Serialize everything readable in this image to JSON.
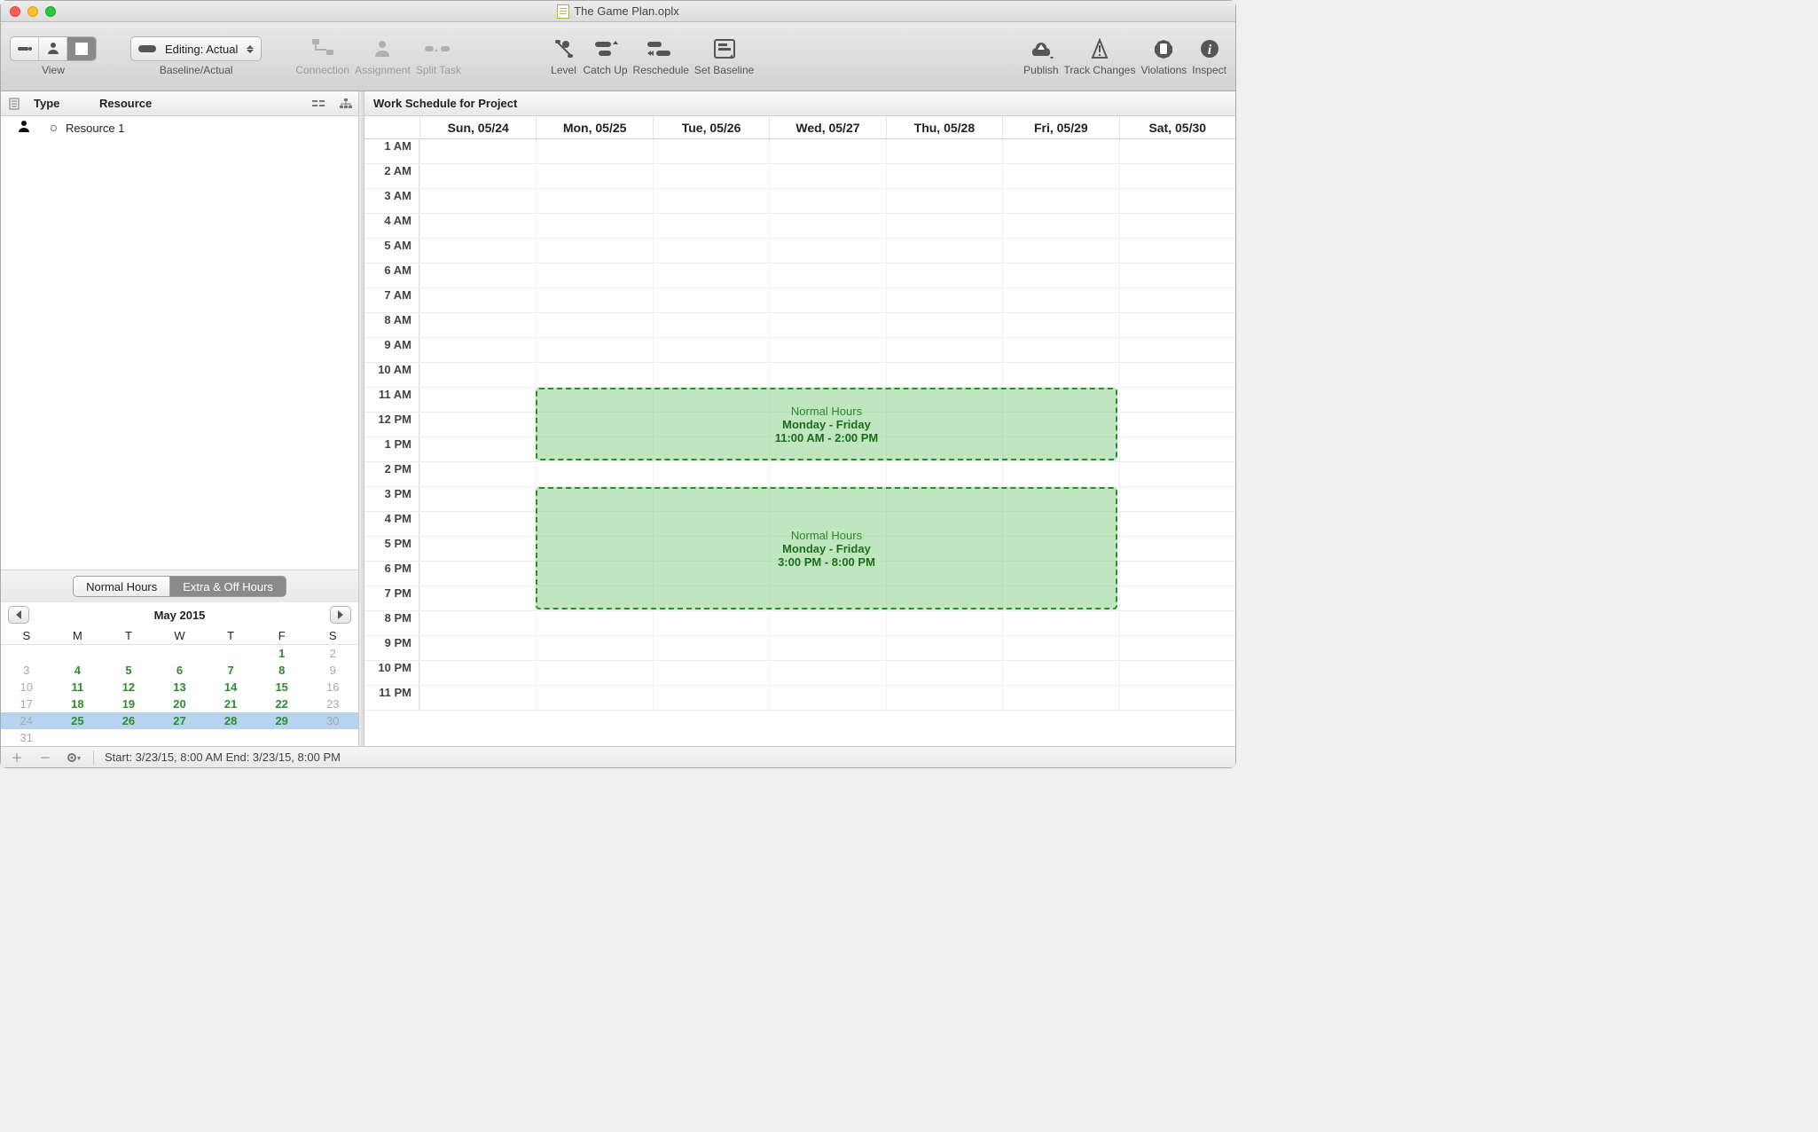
{
  "window": {
    "title": "The Game Plan.oplx"
  },
  "toolbar": {
    "view_label": "View",
    "baseline_actual_label": "Baseline/Actual",
    "editing_label": "Editing: Actual",
    "connection": "Connection",
    "assignment": "Assignment",
    "split_task": "Split Task",
    "level": "Level",
    "catch_up": "Catch Up",
    "reschedule": "Reschedule",
    "set_baseline": "Set Baseline",
    "publish": "Publish",
    "track_changes": "Track Changes",
    "violations": "Violations",
    "inspect": "Inspect"
  },
  "outline": {
    "type_header": "Type",
    "resource_header": "Resource",
    "rows": [
      {
        "name": "Resource 1"
      }
    ]
  },
  "hours_tabs": {
    "normal": "Normal Hours",
    "extra": "Extra & Off Hours"
  },
  "calendar": {
    "month_label": "May 2015",
    "dow": [
      "S",
      "M",
      "T",
      "W",
      "T",
      "F",
      "S"
    ],
    "weeks": [
      [
        {
          "d": "",
          "c": "gray"
        },
        {
          "d": "",
          "c": "gray"
        },
        {
          "d": "",
          "c": "gray"
        },
        {
          "d": "",
          "c": "gray"
        },
        {
          "d": "",
          "c": "gray"
        },
        {
          "d": "1",
          "c": "green"
        },
        {
          "d": "2",
          "c": "gray"
        }
      ],
      [
        {
          "d": "3",
          "c": "gray"
        },
        {
          "d": "4",
          "c": "green"
        },
        {
          "d": "5",
          "c": "green"
        },
        {
          "d": "6",
          "c": "green"
        },
        {
          "d": "7",
          "c": "green"
        },
        {
          "d": "8",
          "c": "green"
        },
        {
          "d": "9",
          "c": "gray"
        }
      ],
      [
        {
          "d": "10",
          "c": "gray"
        },
        {
          "d": "11",
          "c": "green"
        },
        {
          "d": "12",
          "c": "green"
        },
        {
          "d": "13",
          "c": "green"
        },
        {
          "d": "14",
          "c": "green"
        },
        {
          "d": "15",
          "c": "green"
        },
        {
          "d": "16",
          "c": "gray"
        }
      ],
      [
        {
          "d": "17",
          "c": "gray"
        },
        {
          "d": "18",
          "c": "green"
        },
        {
          "d": "19",
          "c": "green"
        },
        {
          "d": "20",
          "c": "green"
        },
        {
          "d": "21",
          "c": "green"
        },
        {
          "d": "22",
          "c": "green"
        },
        {
          "d": "23",
          "c": "gray"
        }
      ],
      [
        {
          "d": "24",
          "c": "gray"
        },
        {
          "d": "25",
          "c": "green"
        },
        {
          "d": "26",
          "c": "green"
        },
        {
          "d": "27",
          "c": "green"
        },
        {
          "d": "28",
          "c": "green"
        },
        {
          "d": "29",
          "c": "green"
        },
        {
          "d": "30",
          "c": "gray"
        }
      ],
      [
        {
          "d": "31",
          "c": "gray"
        },
        {
          "d": "",
          "c": "gray"
        },
        {
          "d": "",
          "c": "gray"
        },
        {
          "d": "",
          "c": "gray"
        },
        {
          "d": "",
          "c": "gray"
        },
        {
          "d": "",
          "c": "gray"
        },
        {
          "d": "",
          "c": "gray"
        }
      ]
    ],
    "selected_week_index": 4
  },
  "schedule": {
    "title": "Work Schedule for Project",
    "days": [
      "Sun, 05/24",
      "Mon, 05/25",
      "Tue, 05/26",
      "Wed, 05/27",
      "Thu, 05/28",
      "Fri, 05/29",
      "Sat, 05/30"
    ],
    "hours": [
      "1 AM",
      "2 AM",
      "3 AM",
      "4 AM",
      "5 AM",
      "6 AM",
      "7 AM",
      "8 AM",
      "9 AM",
      "10 AM",
      "11 AM",
      "12 PM",
      "1 PM",
      "2 PM",
      "3 PM",
      "4 PM",
      "5 PM",
      "6 PM",
      "7 PM",
      "8 PM",
      "9 PM",
      "10 PM",
      "11 PM"
    ],
    "blocks": [
      {
        "label1": "Normal Hours",
        "label2": "Monday - Friday",
        "label3": "11:00 AM - 2:00 PM",
        "start_hour_index": 10,
        "span_hours": 3,
        "start_day": 1,
        "span_days": 5
      },
      {
        "label1": "Normal Hours",
        "label2": "Monday - Friday",
        "label3": "3:00 PM - 8:00 PM",
        "start_hour_index": 14,
        "span_hours": 5,
        "start_day": 1,
        "span_days": 5
      }
    ]
  },
  "statusbar": {
    "text": "Start: 3/23/15, 8:00 AM End: 3/23/15, 8:00 PM"
  }
}
